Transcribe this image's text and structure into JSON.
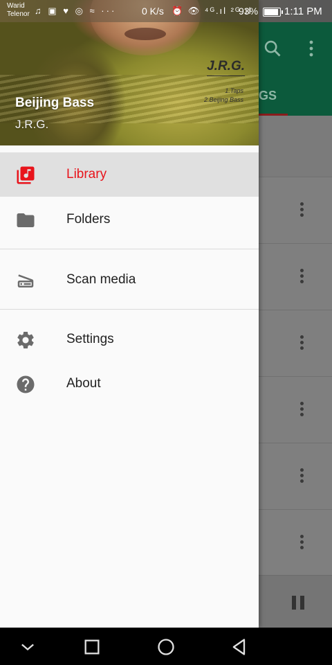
{
  "status_bar": {
    "carrier_line1": "Warid",
    "carrier_line2": "Telenor",
    "notification_icons": "♫ ▣ ♥ ◎ ≈ ···",
    "net_speed": "0 K/s",
    "signal_icons": "⏰ 👁 ⁴ᴳ.ıl ²ᴳ.ıl",
    "battery_percent": "93%",
    "battery_level": 0.93,
    "time": "1:11 PM"
  },
  "drawer": {
    "header": {
      "song_title": "Beijing Bass",
      "artist": "J.R.G.",
      "art_brand": "J.R.G.",
      "art_track1": "1.Taps",
      "art_track2": "2.Beijing Bass"
    },
    "items": [
      {
        "label": "Library",
        "icon": "library-music-icon",
        "active": true
      },
      {
        "label": "Folders",
        "icon": "folder-icon",
        "active": false
      },
      {
        "label": "Scan media",
        "icon": "scanner-icon",
        "active": false
      },
      {
        "label": "Settings",
        "icon": "gear-icon",
        "active": false
      },
      {
        "label": "About",
        "icon": "help-icon",
        "active": false
      }
    ]
  },
  "background_app": {
    "tab_label_fragment": "GS"
  },
  "colors": {
    "accent": "#e8141b",
    "toolbar": "#0c5a3c",
    "drawer_background": "#fafafa",
    "active_item_background": "#e0e0e0"
  }
}
